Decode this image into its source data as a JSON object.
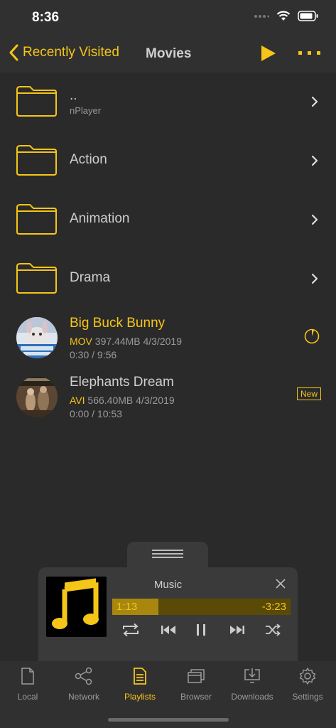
{
  "status": {
    "time": "8:36"
  },
  "nav": {
    "back_label": "Recently Visited",
    "title": "Movies"
  },
  "folders": [
    {
      "name": "..",
      "subtitle": "nPlayer"
    },
    {
      "name": "Action"
    },
    {
      "name": "Animation"
    },
    {
      "name": "Drama"
    }
  ],
  "media": [
    {
      "title": "Big Buck Bunny",
      "format": "MOV",
      "size": "397.44MB",
      "date": "4/3/2019",
      "progress": "0:30 / 9:56",
      "title_color": "#f5c518"
    },
    {
      "title": "Elephants Dream",
      "format": "AVI",
      "size": "566.40MB",
      "date": "4/3/2019",
      "progress": "0:00 / 10:53",
      "badge": "New",
      "title_color": "#cfcfcf"
    }
  ],
  "player": {
    "title": "Music",
    "current_time": "1:13",
    "remaining_time": "-3:23",
    "progress_fraction": 0.26
  },
  "tabs": [
    {
      "label": "Local",
      "icon": "document-icon"
    },
    {
      "label": "Network",
      "icon": "share-icon"
    },
    {
      "label": "Playlists",
      "icon": "playlist-icon"
    },
    {
      "label": "Browser",
      "icon": "browser-icon"
    },
    {
      "label": "Downloads",
      "icon": "download-icon"
    },
    {
      "label": "Settings",
      "icon": "gear-icon"
    }
  ],
  "colors": {
    "accent": "#f5c518",
    "background": "#2a2a2a",
    "bar": "#303030"
  }
}
